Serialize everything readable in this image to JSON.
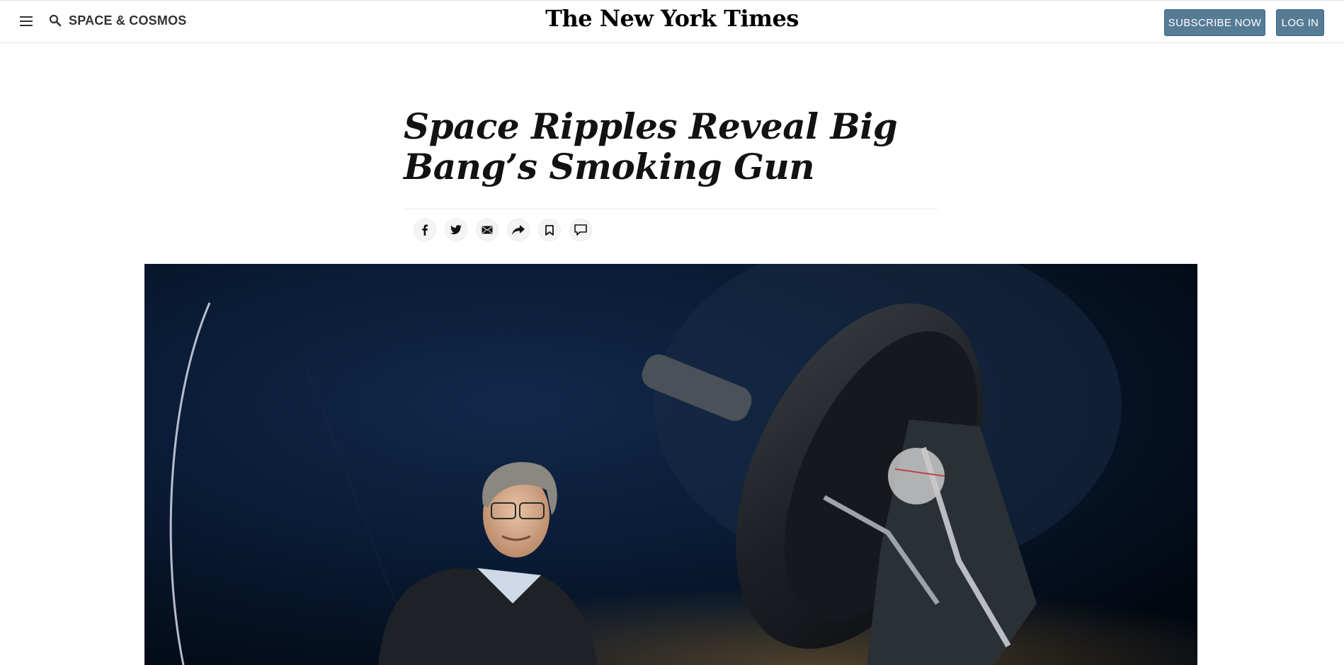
{
  "header": {
    "menu_icon": "hamburger-menu-icon",
    "search_icon": "search-icon",
    "section_label": "SPACE & COSMOS",
    "logo_text": "The New York Times",
    "subscribe_label": "SUBSCRIBE NOW",
    "login_label": "LOG IN",
    "button_color": "#567b95"
  },
  "article": {
    "headline": "Space Ripples Reveal Big Bang’s Smoking Gun"
  },
  "share_tools": [
    {
      "icon": "facebook-icon"
    },
    {
      "icon": "twitter-icon"
    },
    {
      "icon": "email-icon"
    },
    {
      "icon": "share-icon"
    },
    {
      "icon": "bookmark-icon"
    },
    {
      "icon": "comment-icon"
    }
  ],
  "hero_image": {
    "subject": "photo-man-with-telescope"
  }
}
